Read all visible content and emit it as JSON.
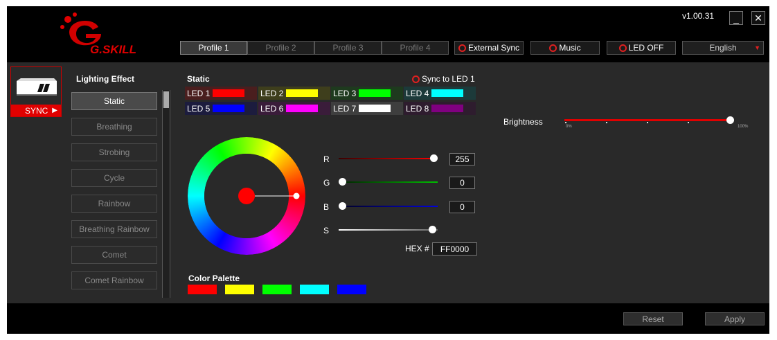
{
  "header": {
    "logo_text": "G.SKILL",
    "version": "v1.00.31",
    "minimize_glyph": "_",
    "close_glyph": "✕",
    "profiles": [
      "Profile 1",
      "Profile 2",
      "Profile 3",
      "Profile 4"
    ],
    "active_profile": 0,
    "external_sync_label": "External Sync",
    "music_label": "Music",
    "led_off_label": "LED OFF",
    "language": "English",
    "language_arrow": "▼"
  },
  "device": {
    "sync_label": "SYNC",
    "sync_arrow": "▶"
  },
  "lighting": {
    "title": "Lighting Effect",
    "effects": [
      "Static",
      "Breathing",
      "Strobing",
      "Cycle",
      "Rainbow",
      "Breathing Rainbow",
      "Comet",
      "Comet Rainbow"
    ],
    "selected": "Static"
  },
  "static_panel": {
    "title": "Static",
    "sync_to_led1": "Sync to LED 1",
    "leds": [
      {
        "label": "LED 1",
        "color": "#ff0000",
        "bg": "#4a1e1e"
      },
      {
        "label": "LED 2",
        "color": "#ffff00",
        "bg": "#3e3e1c"
      },
      {
        "label": "LED 3",
        "color": "#00ff00",
        "bg": "#1e3a1e"
      },
      {
        "label": "LED 4",
        "color": "#00ffff",
        "bg": "#1c3a3a"
      },
      {
        "label": "LED 5",
        "color": "#0000ff",
        "bg": "#1c1c3e"
      },
      {
        "label": "LED 6",
        "color": "#ff00ff",
        "bg": "#3a1c3a"
      },
      {
        "label": "LED 7",
        "color": "#ffffff",
        "bg": "#3e3e3e"
      },
      {
        "label": "LED 8",
        "color": "#800080",
        "bg": "#2e1c2e"
      }
    ],
    "selected_color": "#ff0000"
  },
  "rgb": {
    "r_label": "R",
    "g_label": "G",
    "b_label": "B",
    "s_label": "S",
    "r_value": "255",
    "g_value": "0",
    "b_value": "0",
    "hex_label": "HEX #",
    "hex_value": "FF0000"
  },
  "palette": {
    "title": "Color Palette",
    "colors": [
      "#ff0000",
      "#ffff00",
      "#00ff00",
      "#00ffff",
      "#0000ff"
    ]
  },
  "brightness": {
    "label": "Brightness",
    "min_label": "0%",
    "max_label": "100%",
    "value_percent": 100
  },
  "footer": {
    "reset_label": "Reset",
    "apply_label": "Apply"
  }
}
